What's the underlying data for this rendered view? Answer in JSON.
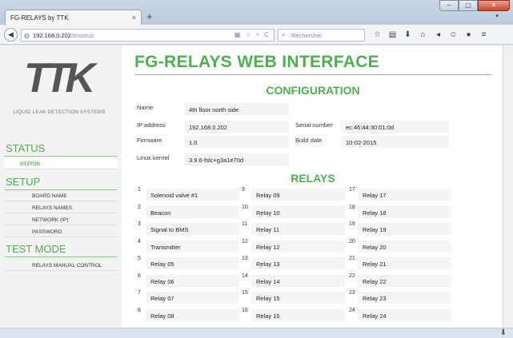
{
  "browser": {
    "tab_title": "FG-RELAYS by TTK",
    "tab_close": "×",
    "new_tab": "+",
    "url_host": "192.168.0.202",
    "url_path": "/#/status",
    "url_tools": "▦ ☆ ▿ C",
    "search_placeholder": "Rechercher",
    "toolbar_icons": [
      "☆",
      "▤",
      "⬇",
      "⌂",
      "◂",
      "☺",
      "●",
      "≡"
    ]
  },
  "sidebar": {
    "logo_text": "TTK",
    "logo_caption": "LIQUID LEAK DETECTION SYSTEMS",
    "status_header": "STATUS",
    "status_item": "STATUS",
    "setup_header": "SETUP",
    "setup_items": [
      "BOARD NAME",
      "RELAYS NAMES",
      "NETWORK (IP)",
      "PASSWORD"
    ],
    "test_header": "TEST MODE",
    "test_items": [
      "RELAYS MANUAL CONTROL"
    ]
  },
  "main": {
    "title": "FG-RELAYS WEB INTERFACE",
    "config_heading": "CONFIGURATION",
    "relays_heading": "RELAYS"
  },
  "config": {
    "name_label": "Name",
    "name_value": "4th floor north side",
    "ip_label": "IP address",
    "ip_value": "192.168.0.202",
    "serial_label": "Serial number",
    "serial_value": "ec:46:44:30:01:0d",
    "firmware_label": "Firmware",
    "firmware_value": "1.0",
    "build_label": "Build date",
    "build_value": "10-02-2015",
    "kernel_label": "Linux kernel",
    "kernel_value": "3.9.6-fslc+g3a1e70d"
  },
  "relays": [
    {
      "num": "1",
      "name": "Solenoid valve #1"
    },
    {
      "num": "2",
      "name": "Beacon"
    },
    {
      "num": "3",
      "name": "Signal to BMS"
    },
    {
      "num": "4",
      "name": "Transmitter"
    },
    {
      "num": "5",
      "name": "Relay 05"
    },
    {
      "num": "6",
      "name": "Relay 06"
    },
    {
      "num": "7",
      "name": "Relay 07"
    },
    {
      "num": "8",
      "name": "Relay 08"
    },
    {
      "num": "9",
      "name": "Relay 09"
    },
    {
      "num": "10",
      "name": "Relay 10"
    },
    {
      "num": "11",
      "name": "Relay 11"
    },
    {
      "num": "12",
      "name": "Relay 12"
    },
    {
      "num": "13",
      "name": "Relay 13"
    },
    {
      "num": "14",
      "name": "Relay 14"
    },
    {
      "num": "15",
      "name": "Relay 15"
    },
    {
      "num": "16",
      "name": "Relay 16"
    },
    {
      "num": "17",
      "name": "Relay 17"
    },
    {
      "num": "18",
      "name": "Relay 18"
    },
    {
      "num": "19",
      "name": "Relay 19"
    },
    {
      "num": "20",
      "name": "Relay 20"
    },
    {
      "num": "21",
      "name": "Relay 21"
    },
    {
      "num": "22",
      "name": "Relay 22"
    },
    {
      "num": "23",
      "name": "Relay 23"
    },
    {
      "num": "24",
      "name": "Relay 24"
    }
  ],
  "colors": {
    "accent": "#4fae4f",
    "sidebar_bg": "#f3f3f3",
    "field_bg": "#f4f4f4"
  }
}
